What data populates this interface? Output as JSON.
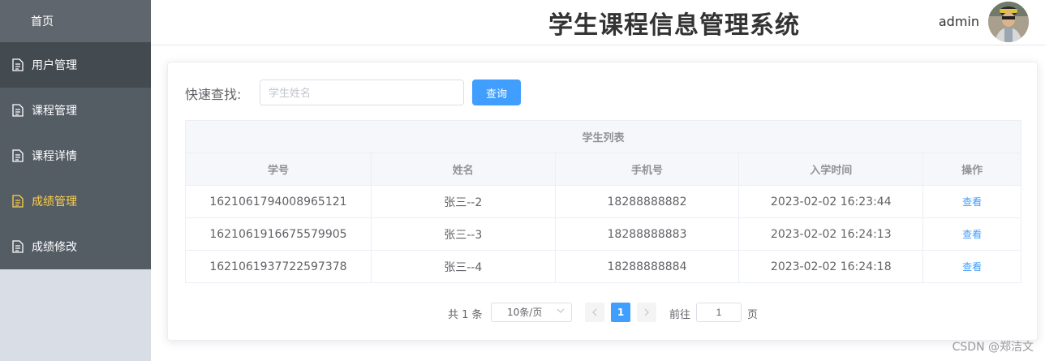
{
  "app": {
    "title": "学生课程信息管理系统"
  },
  "sidebar": {
    "items": [
      {
        "label": "首页"
      },
      {
        "label": "用户管理"
      },
      {
        "label": "课程管理"
      },
      {
        "label": "课程详情"
      },
      {
        "label": "成绩管理"
      },
      {
        "label": "成绩修改"
      }
    ],
    "active_color": "#ffd04b",
    "bg_color": "#545c64"
  },
  "header": {
    "username": "admin"
  },
  "search": {
    "label": "快速查找:",
    "placeholder": "学生姓名",
    "button": "查询"
  },
  "table": {
    "caption": "学生列表",
    "columns": [
      "学号",
      "姓名",
      "手机号",
      "入学时间",
      "操作"
    ],
    "rows": [
      {
        "id": "1621061794008965121",
        "name": "张三--2",
        "phone": "18288888882",
        "time": "2023-02-02 16:23:44",
        "action": "查看"
      },
      {
        "id": "1621061916675579905",
        "name": "张三--3",
        "phone": "18288888883",
        "time": "2023-02-02 16:24:13",
        "action": "查看"
      },
      {
        "id": "1621061937722597378",
        "name": "张三--4",
        "phone": "18288888884",
        "time": "2023-02-02 16:24:18",
        "action": "查看"
      }
    ]
  },
  "pagination": {
    "total": "共 1 条",
    "page_size": "10条/页",
    "current": "1",
    "goto_label": "前往",
    "goto_value": "1",
    "page_unit": "页"
  },
  "watermark": "CSDN @郑洁文",
  "colors": {
    "primary": "#409eff"
  }
}
